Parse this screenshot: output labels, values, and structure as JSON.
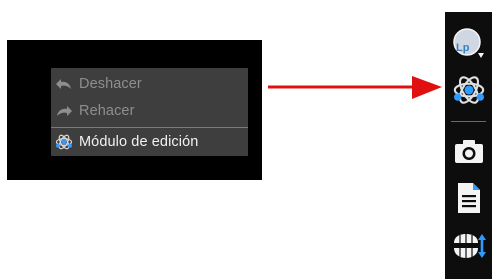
{
  "context_menu": {
    "items": [
      {
        "label": "Deshacer",
        "icon": "undo-icon",
        "enabled": false
      },
      {
        "label": "Rehacer",
        "icon": "redo-icon",
        "enabled": false
      },
      {
        "label": "Módulo de edición",
        "icon": "edit-module-icon",
        "enabled": true
      }
    ]
  },
  "toolbar": {
    "avatar_initials": "Lp",
    "buttons": [
      "user-avatar-icon",
      "edit-module-icon",
      "camera-icon",
      "document-icon",
      "teeth-model-icon"
    ]
  },
  "colors": {
    "arrow": "#e01010",
    "menu_bg": "#3e3e3e",
    "toolbar_bg": "#0d0d0d",
    "accent_blue": "#2f9bff"
  }
}
